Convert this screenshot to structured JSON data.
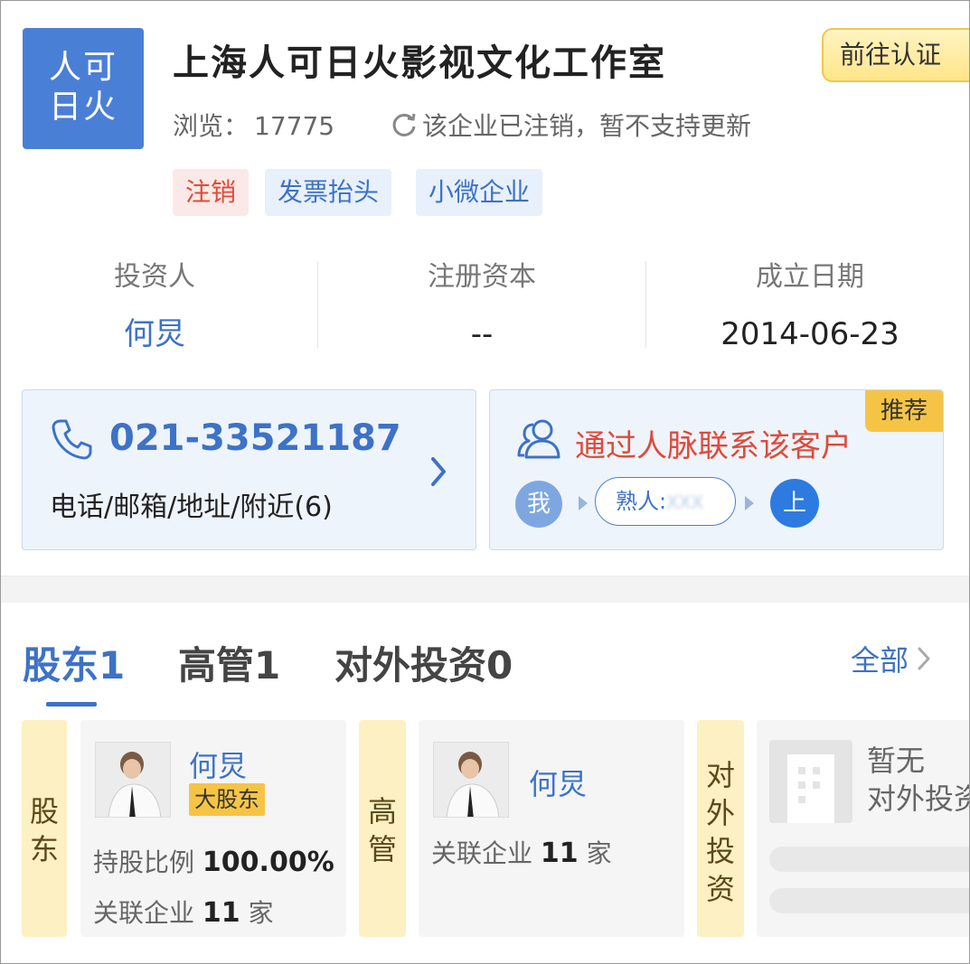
{
  "company": {
    "logo_line1": "人可",
    "logo_line2": "日火",
    "name": "上海人可日火影视文化工作室",
    "verify_button": "前往认证",
    "views_label": "浏览：",
    "views_count": "17775",
    "status_text": "该企业已注销，暂不支持更新",
    "tags": [
      "注销",
      "发票抬头",
      "小微企业"
    ]
  },
  "stats": [
    {
      "label": "投资人",
      "value": "何炅"
    },
    {
      "label": "注册资本",
      "value": "--"
    },
    {
      "label": "成立日期",
      "value": "2014-06-23"
    }
  ],
  "contact_card": {
    "phone": "021-33521187",
    "subtitle": "电话/邮箱/地址/附近(6)"
  },
  "network_card": {
    "badge": "推荐",
    "title": "通过人脉联系该客户",
    "me": "我",
    "acquaintance_label": "熟人:",
    "acquaintance_masked": "XXX",
    "target": "上"
  },
  "tabs": [
    {
      "label": "股东1",
      "active": true
    },
    {
      "label": "高管1",
      "active": false
    },
    {
      "label": "对外投资0",
      "active": false
    }
  ],
  "all_link": "全部",
  "sections": {
    "shareholder": {
      "side_label_1": "股",
      "side_label_2": "东",
      "name": "何炅",
      "badge": "大股东",
      "ratio_label": "持股比例",
      "ratio_value": "100.00%",
      "related_label": "关联企业",
      "related_count": "11",
      "related_unit": "家"
    },
    "executive": {
      "side_label_1": "高",
      "side_label_2": "管",
      "name": "何炅",
      "related_label": "关联企业",
      "related_count": "11",
      "related_unit": "家"
    },
    "investment": {
      "side_label_1": "对",
      "side_label_2": "外",
      "side_label_3": "投",
      "side_label_4": "资",
      "empty_line1": "暂无",
      "empty_line2": "对外投资"
    }
  },
  "colors": {
    "brand_blue": "#3d72c6",
    "logo_blue": "#4a7fd6",
    "alert_red": "#e04a3a",
    "badge_yellow": "#f6c445"
  },
  "icons": [
    "refresh-icon",
    "phone-icon",
    "chevron-right-icon",
    "people-icon",
    "building-icon"
  ]
}
